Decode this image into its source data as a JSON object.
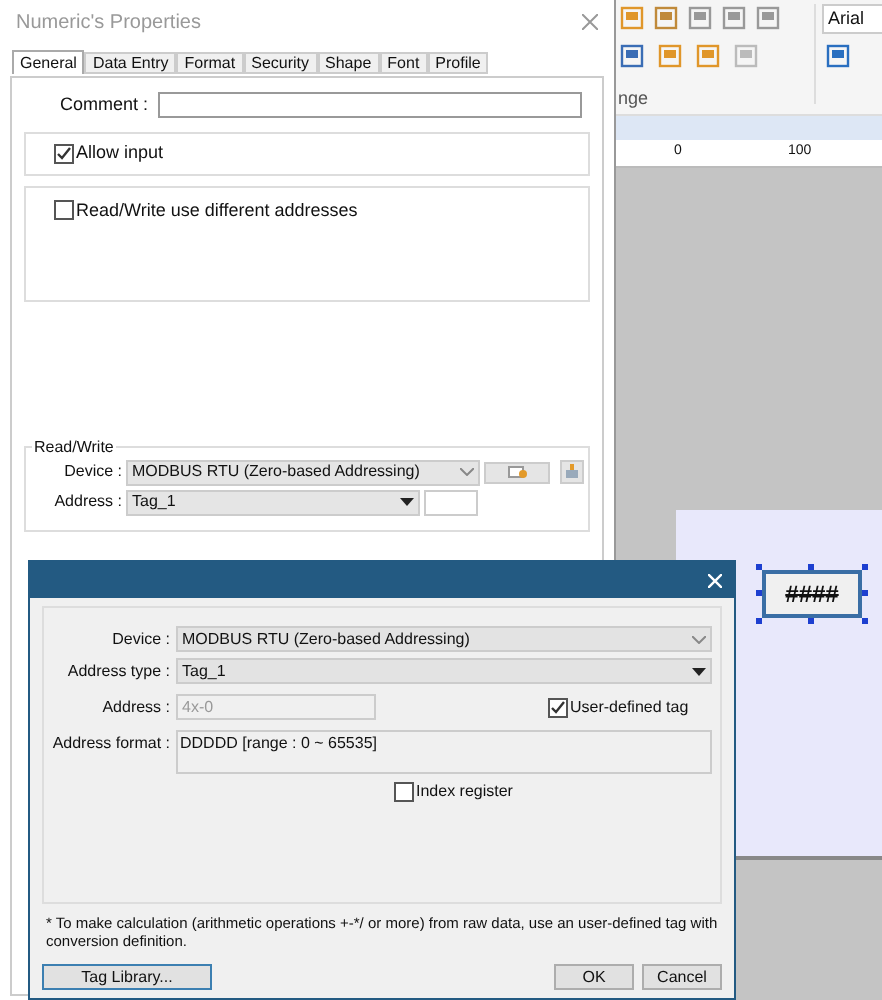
{
  "background_app": {
    "font_field": "Arial",
    "ribbon_group_label": "nge",
    "ruler_labels": [
      "0",
      "100"
    ],
    "canvas_object_text": "####"
  },
  "properties_dialog": {
    "title": "Numeric's Properties",
    "tabs": [
      {
        "label": "General",
        "selected": true
      },
      {
        "label": "Data Entry",
        "selected": false
      },
      {
        "label": "Format",
        "selected": false
      },
      {
        "label": "Security",
        "selected": false
      },
      {
        "label": "Shape",
        "selected": false
      },
      {
        "label": "Font",
        "selected": false
      },
      {
        "label": "Profile",
        "selected": false
      }
    ],
    "comment_label": "Comment :",
    "allow_input": {
      "label": "Allow input",
      "checked": true
    },
    "different_addresses": {
      "label": "Read/Write use different addresses",
      "checked": false
    },
    "read_write": {
      "title": "Read/Write",
      "device_label": "Device :",
      "device": "MODBUS RTU (Zero-based Addressing)",
      "address_label": "Address :",
      "address": "Tag_1"
    }
  },
  "tag_dialog": {
    "device_label": "Device :",
    "device": "MODBUS RTU (Zero-based Addressing)",
    "address_type_label": "Address type :",
    "address_type": "Tag_1",
    "address_label": "Address :",
    "address": "4x-0",
    "user_defined_tag": {
      "label": "User-defined tag",
      "checked": true
    },
    "address_format_label": "Address format :",
    "address_format": "DDDDD [range : 0 ~ 65535]",
    "index_register": {
      "label": "Index register",
      "checked": false
    },
    "note": "* To make calculation (arithmetic operations +-*/ or more) from raw data, use an user-defined tag with conversion definition.",
    "buttons": [
      "Tag Library...",
      "OK",
      "Cancel"
    ]
  }
}
